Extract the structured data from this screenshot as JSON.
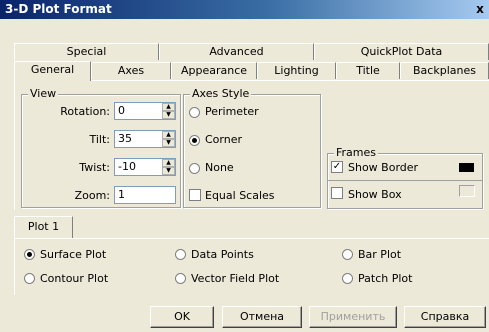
{
  "window": {
    "title": "3-D Plot Format",
    "close_glyph": "x"
  },
  "tabs_back": [
    "Special",
    "Advanced",
    "QuickPlot Data"
  ],
  "tabs_front": [
    "General",
    "Axes",
    "Appearance",
    "Lighting",
    "Title",
    "Backplanes"
  ],
  "active_tab": "General",
  "view": {
    "title": "View",
    "rotation_label": "Rotation:",
    "rotation": "0",
    "tilt_label": "Tilt:",
    "tilt": "35",
    "twist_label": "Twist:",
    "twist": "-10",
    "zoom_label": "Zoom:",
    "zoom": "1"
  },
  "axes_style": {
    "title": "Axes Style",
    "perimeter": "Perimeter",
    "corner": "Corner",
    "none": "None",
    "equal_scales": "Equal Scales",
    "selected": "Corner"
  },
  "frames": {
    "title": "Frames",
    "show_border": "Show Border",
    "show_box": "Show Box",
    "border_color": "#000000",
    "box_color": "#ece9d8"
  },
  "plot_tab": "Plot 1",
  "plot_types": {
    "surface": "Surface Plot",
    "data_points": "Data Points",
    "bar": "Bar Plot",
    "contour": "Contour Plot",
    "vector": "Vector Field Plot",
    "patch": "Patch Plot",
    "selected": "Surface Plot"
  },
  "buttons": {
    "ok": "OK",
    "cancel": "Отмена",
    "apply": "Применить",
    "help": "Справка"
  }
}
